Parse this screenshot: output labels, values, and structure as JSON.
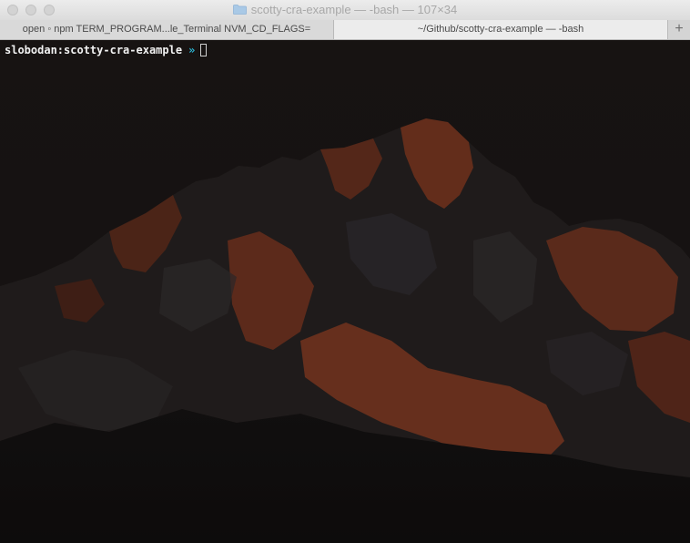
{
  "window": {
    "title": "scotty-cra-example — -bash — 107×34"
  },
  "tabs": [
    {
      "label": "open ◦ npm TERM_PROGRAM...le_Terminal NVM_CD_FLAGS=",
      "active": false
    },
    {
      "label": "~/Github/scotty-cra-example — -bash",
      "active": true
    }
  ],
  "tab_add_label": "+",
  "terminal": {
    "prompt": "slobodan:scotty-cra-example",
    "prompt_symbol": "»",
    "input": ""
  },
  "icons": {
    "title_icon": "folder-icon",
    "new_tab": "plus-icon"
  },
  "colors": {
    "prompt_text": "#f2f2f2",
    "prompt_symbol": "#2cb8d6",
    "mountain_highlight": "#a44a2c",
    "background": "#1d1817"
  }
}
